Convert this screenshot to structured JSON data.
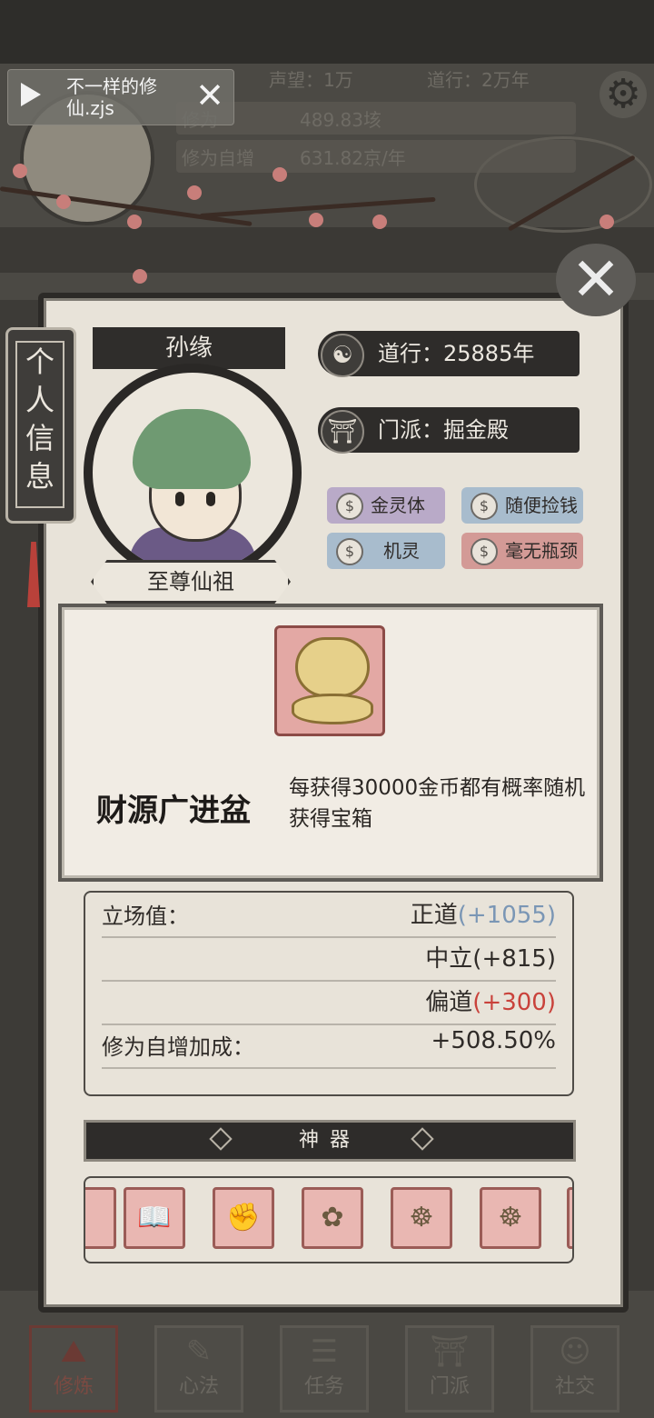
{
  "hud": {
    "reputation": "声望：1万",
    "daoxing": "道行：2万年",
    "cultivation_label": "修为",
    "cultivation_value": "489.83垓",
    "auto_gain_label": "修为自增",
    "auto_gain_value": "631.82京/年"
  },
  "toast": {
    "title": "不一样的修仙.zjs"
  },
  "side_tab": {
    "label": "个人信息"
  },
  "profile": {
    "name": "孙缘",
    "title": "至尊仙祖",
    "daoxing": "道行：25885年",
    "sect": "门派：掘金殿"
  },
  "traits": [
    {
      "label": "金灵体",
      "color": "#b9aac8"
    },
    {
      "label": "随便捡钱",
      "color": "#a8bccd"
    },
    {
      "label": "机灵",
      "color": "#a8bccd"
    },
    {
      "label": "毫无瓶颈",
      "color": "#d39a96"
    }
  ],
  "item_popup": {
    "name": "财源广进盆",
    "description": "每获得30000金币都有概率随机获得宝箱",
    "icon": "money-tree-pot-icon"
  },
  "stats": {
    "stance_label": "立场值：",
    "righteous": "正道",
    "righteous_bonus": "(+1055)",
    "neutral": "中立(+815)",
    "deviant": "偏道",
    "deviant_bonus": "(+300)",
    "cultivation_bonus_label": "修为自增加成：",
    "cultivation_bonus_value": "+508.50%"
  },
  "artifacts": {
    "header": "神器",
    "items": [
      "book-icon",
      "gauntlet-icon",
      "money-tree-icon",
      "buddha-statue-icon",
      "buddha-statue-icon"
    ]
  },
  "nav": [
    "修炼",
    "心法",
    "任务",
    "门派",
    "社交"
  ],
  "colors": {
    "accent_red": "#c9423b",
    "accent_blue": "#7a96b5",
    "panel_bg": "#e8e3d9"
  }
}
